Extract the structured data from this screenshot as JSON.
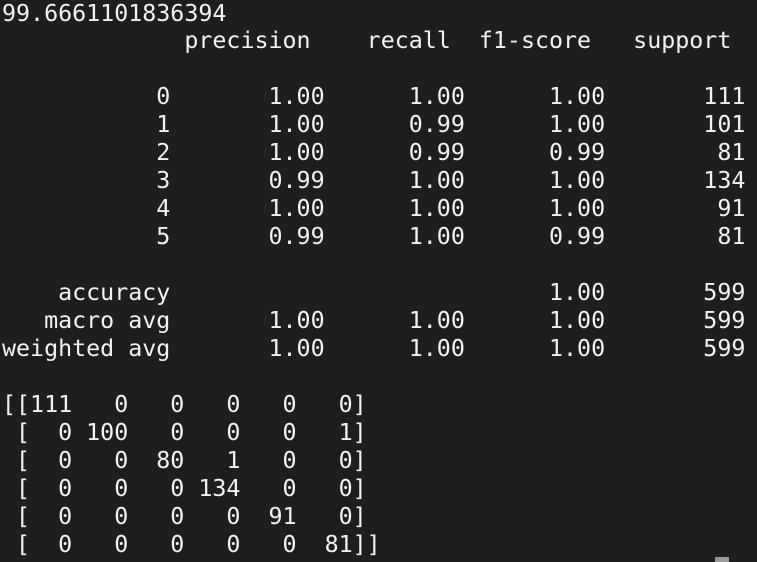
{
  "terminal": {
    "accuracy_score": "99.6661101836394",
    "report": {
      "header": "             precision    recall  f1-score   support",
      "class_rows": [
        "           0       1.00      1.00      1.00       111",
        "           1       1.00      0.99      1.00       101",
        "           2       1.00      0.99      0.99        81",
        "           3       0.99      1.00      1.00       134",
        "           4       1.00      1.00      1.00        91",
        "           5       0.99      1.00      0.99        81"
      ],
      "summary_rows": [
        "    accuracy                           1.00       599",
        "   macro avg       1.00      1.00      1.00       599",
        "weighted avg       1.00      1.00      1.00       599"
      ]
    },
    "confusion_matrix": [
      "[[111   0   0   0   0   0]",
      " [  0 100   0   0   0   1]",
      " [  0   0  80   1   0   0]",
      " [  0   0   0 134   0   0]",
      " [  0   0   0   0  91   0]",
      " [  0   0   0   0   0  81]]"
    ]
  }
}
